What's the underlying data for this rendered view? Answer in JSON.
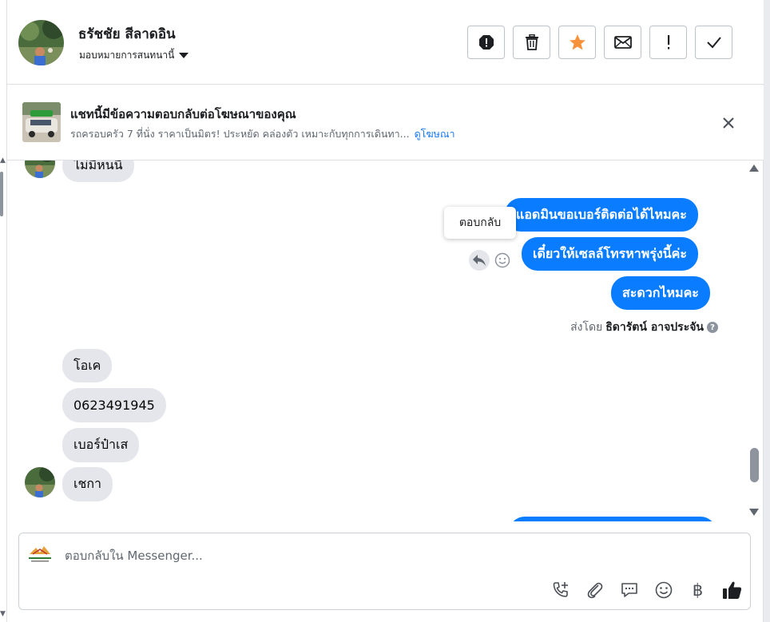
{
  "header": {
    "contact_name": "ธรัชชัย สีลาดอิน",
    "assign_label": "มอบหมายการสนทนานี้",
    "actions": [
      {
        "name": "spam-icon",
        "label": "spam"
      },
      {
        "name": "trash-icon",
        "label": "delete"
      },
      {
        "name": "star-icon",
        "label": "star",
        "color": "#f7923b"
      },
      {
        "name": "mail-icon",
        "label": "mark unread"
      },
      {
        "name": "exclamation-icon",
        "label": "follow up"
      },
      {
        "name": "check-icon",
        "label": "done"
      }
    ]
  },
  "ad_banner": {
    "title": "แชทนี้มีข้อความตอบกลับต่อโฆษณาของคุณ",
    "description": "รถครอบครัว 7 ที่นั่ง ราคาเป็นมิตร! ประหยัด คล่องตัว เหมาะกับทุกการเดินทา...",
    "link": "ดูโฆษณา"
  },
  "messages": {
    "incoming_top": "ไม่มีหนนี",
    "outgoing": [
      "แอดมินขอเบอร์ติดต่อได้ไหมคะ",
      "เดี๋ยวให้เซลล์โทรหาพรุ่งนี้ค่ะ",
      "สะดวกไหมคะ"
    ],
    "tooltip": "ตอบกลับ",
    "sent_by_prefix": "ส่งโดย",
    "sent_by_name": "ธิดารัตน์ อาจประจัน",
    "incoming": [
      "โอเค",
      "0623491945",
      "เบอร์ป๋าเส",
      "เชกา"
    ]
  },
  "composer": {
    "placeholder": "ตอบกลับใน Messenger...",
    "tools": [
      "phone-plus-icon",
      "paperclip-icon",
      "saved-reply-icon",
      "emoji-icon",
      "baht-icon",
      "thumbs-up-icon"
    ],
    "baht_symbol": "฿"
  },
  "colors": {
    "accent": "#0a7cff",
    "incoming_bubble": "#e4e6eb",
    "link": "#1877f2"
  }
}
